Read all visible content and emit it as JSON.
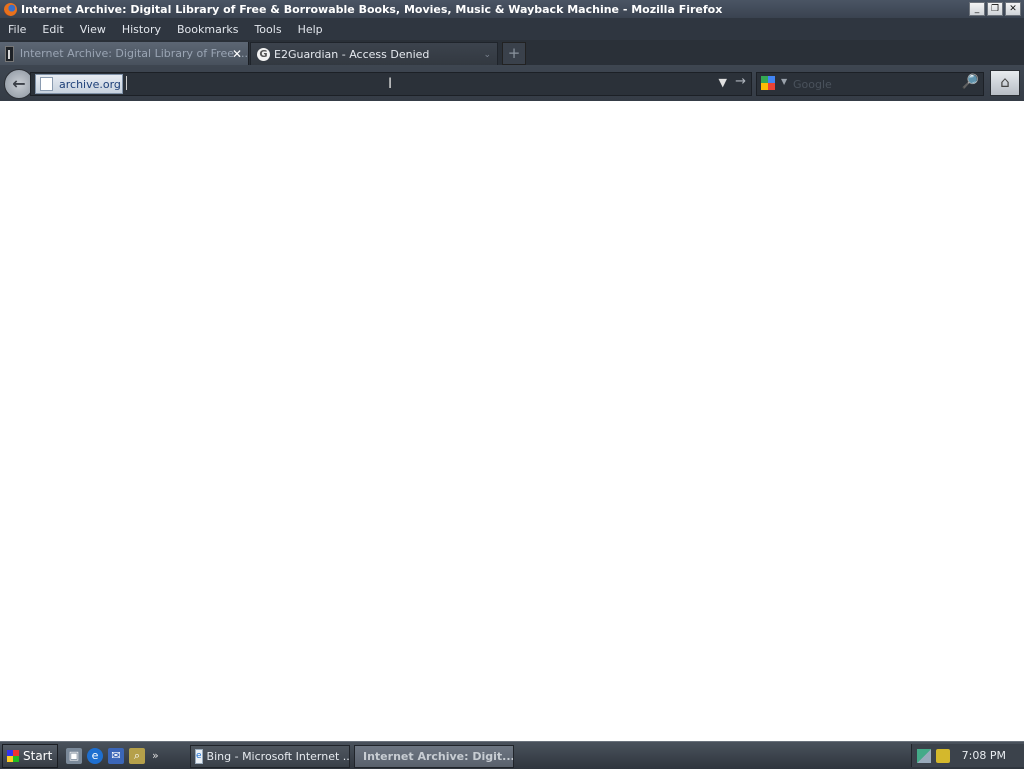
{
  "window": {
    "title": "Internet Archive: Digital Library of Free & Borrowable Books, Movies, Music & Wayback Machine - Mozilla Firefox",
    "buttons": {
      "minimize": "_",
      "maximize": "❐",
      "close": "✕"
    }
  },
  "menubar": {
    "items": [
      {
        "label": "File"
      },
      {
        "label": "Edit"
      },
      {
        "label": "View"
      },
      {
        "label": "History"
      },
      {
        "label": "Bookmarks"
      },
      {
        "label": "Tools"
      },
      {
        "label": "Help"
      }
    ]
  },
  "tabs": [
    {
      "label": "Internet Archive: Digital Library of Free ...",
      "active": true,
      "close": "✕"
    },
    {
      "label": "E2Guardian - Access Denied",
      "active": false,
      "icon_text": "G"
    }
  ],
  "navbar": {
    "identity_label": "archive.org",
    "url_value": "",
    "search_placeholder": "Google",
    "dropdown_glyph": "▼",
    "go_glyph": "→",
    "back_glyph": "←",
    "home_glyph": "⌂",
    "search_glyph": "🔎"
  },
  "taskbar": {
    "start_label": "Start",
    "chevron": "»",
    "tasks": [
      {
        "label": "Bing - Microsoft Internet ..."
      },
      {
        "label": "Internet Archive: Digit..."
      }
    ],
    "clock": "7:08 PM"
  }
}
